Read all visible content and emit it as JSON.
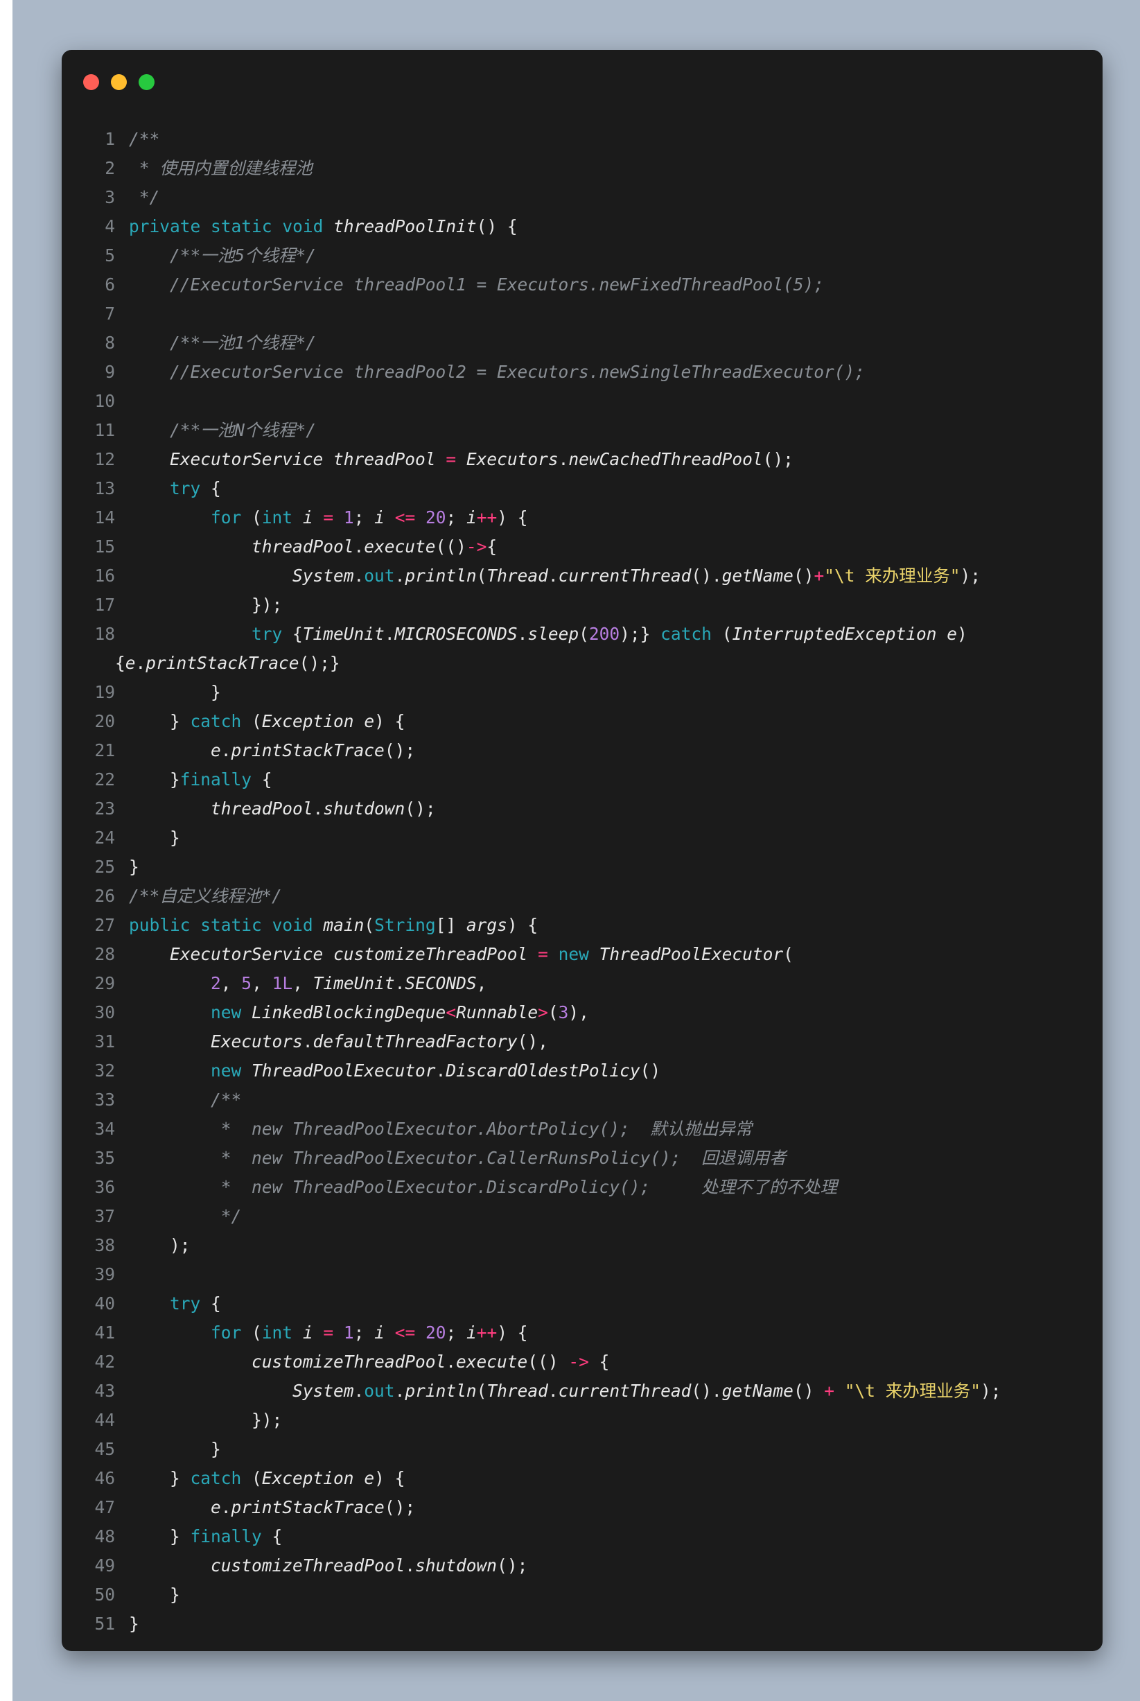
{
  "window": {
    "controls": [
      "close",
      "minimize",
      "maximize"
    ],
    "colors": {
      "close": "#ff5f56",
      "minimize": "#ffbd2e",
      "maximize": "#27c93f",
      "background": "#1b1b1b",
      "page_background": "#abb8c8"
    }
  },
  "palette": {
    "keyword": "#2aa8b8",
    "comment": "#8a8f95",
    "number": "#b77ee0",
    "operator": "#ff3d7f",
    "string": "#ead36a",
    "text": "#e6e6e6"
  },
  "lines": [
    {
      "n": "1",
      "tokens": [
        [
          "c",
          "/**"
        ]
      ]
    },
    {
      "n": "2",
      "tokens": [
        [
          "c",
          " * 使用内置创建线程池"
        ]
      ]
    },
    {
      "n": "3",
      "tokens": [
        [
          "c",
          " */"
        ]
      ]
    },
    {
      "n": "4",
      "tokens": [
        [
          "k",
          "private"
        ],
        [
          "p",
          " "
        ],
        [
          "k",
          "static"
        ],
        [
          "p",
          " "
        ],
        [
          "k",
          "void"
        ],
        [
          "p",
          " "
        ],
        [
          "it",
          "threadPoolInit"
        ],
        [
          "p",
          "() {"
        ]
      ]
    },
    {
      "n": "5",
      "tokens": [
        [
          "p",
          "    "
        ],
        [
          "c",
          "/**一池5个线程*/"
        ]
      ]
    },
    {
      "n": "6",
      "tokens": [
        [
          "p",
          "    "
        ],
        [
          "c",
          "//ExecutorService threadPool1 = Executors.newFixedThreadPool(5);"
        ]
      ]
    },
    {
      "n": "7",
      "tokens": []
    },
    {
      "n": "8",
      "tokens": [
        [
          "p",
          "    "
        ],
        [
          "c",
          "/**一池1个线程*/"
        ]
      ]
    },
    {
      "n": "9",
      "tokens": [
        [
          "p",
          "    "
        ],
        [
          "c",
          "//ExecutorService threadPool2 = Executors.newSingleThreadExecutor();"
        ]
      ]
    },
    {
      "n": "10",
      "tokens": []
    },
    {
      "n": "11",
      "tokens": [
        [
          "p",
          "    "
        ],
        [
          "c",
          "/**一池N个线程*/"
        ]
      ]
    },
    {
      "n": "12",
      "tokens": [
        [
          "p",
          "    "
        ],
        [
          "it",
          "ExecutorService"
        ],
        [
          "p",
          " "
        ],
        [
          "it",
          "threadPool"
        ],
        [
          "p",
          " "
        ],
        [
          "o",
          "="
        ],
        [
          "p",
          " "
        ],
        [
          "it",
          "Executors"
        ],
        [
          "p",
          "."
        ],
        [
          "it",
          "newCachedThreadPool"
        ],
        [
          "p",
          "();"
        ]
      ]
    },
    {
      "n": "13",
      "tokens": [
        [
          "p",
          "    "
        ],
        [
          "k",
          "try"
        ],
        [
          "p",
          " {"
        ]
      ]
    },
    {
      "n": "14",
      "tokens": [
        [
          "p",
          "        "
        ],
        [
          "k",
          "for"
        ],
        [
          "p",
          " ("
        ],
        [
          "k",
          "int"
        ],
        [
          "p",
          " "
        ],
        [
          "it",
          "i"
        ],
        [
          "p",
          " "
        ],
        [
          "o",
          "="
        ],
        [
          "p",
          " "
        ],
        [
          "n",
          "1"
        ],
        [
          "p",
          "; "
        ],
        [
          "it",
          "i"
        ],
        [
          "p",
          " "
        ],
        [
          "o",
          "<="
        ],
        [
          "p",
          " "
        ],
        [
          "n",
          "20"
        ],
        [
          "p",
          "; "
        ],
        [
          "it",
          "i"
        ],
        [
          "o",
          "++"
        ],
        [
          "p",
          ") {"
        ]
      ]
    },
    {
      "n": "15",
      "tokens": [
        [
          "p",
          "            "
        ],
        [
          "it",
          "threadPool"
        ],
        [
          "p",
          "."
        ],
        [
          "it",
          "execute"
        ],
        [
          "p",
          "(()"
        ],
        [
          "o",
          "->"
        ],
        [
          "p",
          "{"
        ]
      ]
    },
    {
      "n": "16",
      "tokens": [
        [
          "p",
          "                "
        ],
        [
          "it",
          "System"
        ],
        [
          "p",
          "."
        ],
        [
          "k",
          "out"
        ],
        [
          "p",
          "."
        ],
        [
          "it",
          "println"
        ],
        [
          "p",
          "("
        ],
        [
          "it",
          "Thread"
        ],
        [
          "p",
          "."
        ],
        [
          "it",
          "currentThread"
        ],
        [
          "p",
          "()."
        ],
        [
          "it",
          "getName"
        ],
        [
          "p",
          "()"
        ],
        [
          "o",
          "+"
        ],
        [
          "s",
          "\"\\t 来办理业务\""
        ],
        [
          "p",
          ");"
        ]
      ]
    },
    {
      "n": "17",
      "tokens": [
        [
          "p",
          "            });"
        ]
      ]
    },
    {
      "n": "18",
      "wrap": true,
      "tokens": [
        [
          "p",
          "            "
        ],
        [
          "k",
          "try"
        ],
        [
          "p",
          " {"
        ],
        [
          "it",
          "TimeUnit"
        ],
        [
          "p",
          "."
        ],
        [
          "it",
          "MICROSECONDS"
        ],
        [
          "p",
          "."
        ],
        [
          "it",
          "sleep"
        ],
        [
          "p",
          "("
        ],
        [
          "n",
          "200"
        ],
        [
          "p",
          ");} "
        ],
        [
          "k",
          "catch"
        ],
        [
          "p",
          " ("
        ],
        [
          "it",
          "InterruptedException"
        ],
        [
          "p",
          " "
        ],
        [
          "it",
          "e"
        ],
        [
          "p",
          ")"
        ]
      ],
      "cont": [
        [
          "p",
          "{"
        ],
        [
          "it",
          "e"
        ],
        [
          "p",
          "."
        ],
        [
          "it",
          "printStackTrace"
        ],
        [
          "p",
          "();}"
        ]
      ]
    },
    {
      "n": "19",
      "tokens": [
        [
          "p",
          "        }"
        ]
      ]
    },
    {
      "n": "20",
      "tokens": [
        [
          "p",
          "    } "
        ],
        [
          "k",
          "catch"
        ],
        [
          "p",
          " ("
        ],
        [
          "it",
          "Exception"
        ],
        [
          "p",
          " "
        ],
        [
          "it",
          "e"
        ],
        [
          "p",
          ") {"
        ]
      ]
    },
    {
      "n": "21",
      "tokens": [
        [
          "p",
          "        "
        ],
        [
          "it",
          "e"
        ],
        [
          "p",
          "."
        ],
        [
          "it",
          "printStackTrace"
        ],
        [
          "p",
          "();"
        ]
      ]
    },
    {
      "n": "22",
      "tokens": [
        [
          "p",
          "    }"
        ],
        [
          "k",
          "finally"
        ],
        [
          "p",
          " {"
        ]
      ]
    },
    {
      "n": "23",
      "tokens": [
        [
          "p",
          "        "
        ],
        [
          "it",
          "threadPool"
        ],
        [
          "p",
          "."
        ],
        [
          "it",
          "shutdown"
        ],
        [
          "p",
          "();"
        ]
      ]
    },
    {
      "n": "24",
      "tokens": [
        [
          "p",
          "    }"
        ]
      ]
    },
    {
      "n": "25",
      "tokens": [
        [
          "p",
          "}"
        ]
      ]
    },
    {
      "n": "26",
      "tokens": [
        [
          "c",
          "/**自定义线程池*/"
        ]
      ]
    },
    {
      "n": "27",
      "tokens": [
        [
          "k",
          "public"
        ],
        [
          "p",
          " "
        ],
        [
          "k",
          "static"
        ],
        [
          "p",
          " "
        ],
        [
          "k",
          "void"
        ],
        [
          "p",
          " "
        ],
        [
          "it",
          "main"
        ],
        [
          "p",
          "("
        ],
        [
          "k",
          "String"
        ],
        [
          "p",
          "[] "
        ],
        [
          "it",
          "args"
        ],
        [
          "p",
          ") {"
        ]
      ]
    },
    {
      "n": "28",
      "tokens": [
        [
          "p",
          "    "
        ],
        [
          "it",
          "ExecutorService"
        ],
        [
          "p",
          " "
        ],
        [
          "it",
          "customizeThreadPool"
        ],
        [
          "p",
          " "
        ],
        [
          "o",
          "="
        ],
        [
          "p",
          " "
        ],
        [
          "k",
          "new"
        ],
        [
          "p",
          " "
        ],
        [
          "it",
          "ThreadPoolExecutor"
        ],
        [
          "p",
          "("
        ]
      ]
    },
    {
      "n": "29",
      "tokens": [
        [
          "p",
          "        "
        ],
        [
          "n",
          "2"
        ],
        [
          "p",
          ", "
        ],
        [
          "n",
          "5"
        ],
        [
          "p",
          ", "
        ],
        [
          "n",
          "1L"
        ],
        [
          "p",
          ", "
        ],
        [
          "it",
          "TimeUnit"
        ],
        [
          "p",
          "."
        ],
        [
          "it",
          "SECONDS"
        ],
        [
          "p",
          ","
        ]
      ]
    },
    {
      "n": "30",
      "tokens": [
        [
          "p",
          "        "
        ],
        [
          "k",
          "new"
        ],
        [
          "p",
          " "
        ],
        [
          "it",
          "LinkedBlockingDeque"
        ],
        [
          "o",
          "<"
        ],
        [
          "it",
          "Runnable"
        ],
        [
          "o",
          ">"
        ],
        [
          "p",
          "("
        ],
        [
          "n",
          "3"
        ],
        [
          "p",
          "),"
        ]
      ]
    },
    {
      "n": "31",
      "tokens": [
        [
          "p",
          "        "
        ],
        [
          "it",
          "Executors"
        ],
        [
          "p",
          "."
        ],
        [
          "it",
          "defaultThreadFactory"
        ],
        [
          "p",
          "(),"
        ]
      ]
    },
    {
      "n": "32",
      "tokens": [
        [
          "p",
          "        "
        ],
        [
          "k",
          "new"
        ],
        [
          "p",
          " "
        ],
        [
          "it",
          "ThreadPoolExecutor"
        ],
        [
          "p",
          "."
        ],
        [
          "it",
          "DiscardOldestPolicy"
        ],
        [
          "p",
          "()"
        ]
      ]
    },
    {
      "n": "33",
      "tokens": [
        [
          "p",
          "        "
        ],
        [
          "c",
          "/**"
        ]
      ]
    },
    {
      "n": "34",
      "tokens": [
        [
          "p",
          "        "
        ],
        [
          "c",
          " *  new ThreadPoolExecutor.AbortPolicy();  默认抛出异常"
        ]
      ]
    },
    {
      "n": "35",
      "tokens": [
        [
          "p",
          "        "
        ],
        [
          "c",
          " *  new ThreadPoolExecutor.CallerRunsPolicy();  回退调用者"
        ]
      ]
    },
    {
      "n": "36",
      "tokens": [
        [
          "p",
          "        "
        ],
        [
          "c",
          " *  new ThreadPoolExecutor.DiscardPolicy();     处理不了的不处理"
        ]
      ]
    },
    {
      "n": "37",
      "tokens": [
        [
          "p",
          "        "
        ],
        [
          "c",
          " */"
        ]
      ]
    },
    {
      "n": "38",
      "tokens": [
        [
          "p",
          "    );"
        ]
      ]
    },
    {
      "n": "39",
      "tokens": []
    },
    {
      "n": "40",
      "tokens": [
        [
          "p",
          "    "
        ],
        [
          "k",
          "try"
        ],
        [
          "p",
          " {"
        ]
      ]
    },
    {
      "n": "41",
      "tokens": [
        [
          "p",
          "        "
        ],
        [
          "k",
          "for"
        ],
        [
          "p",
          " ("
        ],
        [
          "k",
          "int"
        ],
        [
          "p",
          " "
        ],
        [
          "it",
          "i"
        ],
        [
          "p",
          " "
        ],
        [
          "o",
          "="
        ],
        [
          "p",
          " "
        ],
        [
          "n",
          "1"
        ],
        [
          "p",
          "; "
        ],
        [
          "it",
          "i"
        ],
        [
          "p",
          " "
        ],
        [
          "o",
          "<="
        ],
        [
          "p",
          " "
        ],
        [
          "n",
          "20"
        ],
        [
          "p",
          "; "
        ],
        [
          "it",
          "i"
        ],
        [
          "o",
          "++"
        ],
        [
          "p",
          ") {"
        ]
      ]
    },
    {
      "n": "42",
      "tokens": [
        [
          "p",
          "            "
        ],
        [
          "it",
          "customizeThreadPool"
        ],
        [
          "p",
          "."
        ],
        [
          "it",
          "execute"
        ],
        [
          "p",
          "(() "
        ],
        [
          "o",
          "->"
        ],
        [
          "p",
          " {"
        ]
      ]
    },
    {
      "n": "43",
      "tokens": [
        [
          "p",
          "                "
        ],
        [
          "it",
          "System"
        ],
        [
          "p",
          "."
        ],
        [
          "k",
          "out"
        ],
        [
          "p",
          "."
        ],
        [
          "it",
          "println"
        ],
        [
          "p",
          "("
        ],
        [
          "it",
          "Thread"
        ],
        [
          "p",
          "."
        ],
        [
          "it",
          "currentThread"
        ],
        [
          "p",
          "()."
        ],
        [
          "it",
          "getName"
        ],
        [
          "p",
          "() "
        ],
        [
          "o",
          "+"
        ],
        [
          "p",
          " "
        ],
        [
          "s",
          "\"\\t 来办理业务\""
        ],
        [
          "p",
          ");"
        ]
      ]
    },
    {
      "n": "44",
      "tokens": [
        [
          "p",
          "            });"
        ]
      ]
    },
    {
      "n": "45",
      "tokens": [
        [
          "p",
          "        }"
        ]
      ]
    },
    {
      "n": "46",
      "tokens": [
        [
          "p",
          "    } "
        ],
        [
          "k",
          "catch"
        ],
        [
          "p",
          " ("
        ],
        [
          "it",
          "Exception"
        ],
        [
          "p",
          " "
        ],
        [
          "it",
          "e"
        ],
        [
          "p",
          ") {"
        ]
      ]
    },
    {
      "n": "47",
      "tokens": [
        [
          "p",
          "        "
        ],
        [
          "it",
          "e"
        ],
        [
          "p",
          "."
        ],
        [
          "it",
          "printStackTrace"
        ],
        [
          "p",
          "();"
        ]
      ]
    },
    {
      "n": "48",
      "tokens": [
        [
          "p",
          "    } "
        ],
        [
          "k",
          "finally"
        ],
        [
          "p",
          " {"
        ]
      ]
    },
    {
      "n": "49",
      "tokens": [
        [
          "p",
          "        "
        ],
        [
          "it",
          "customizeThreadPool"
        ],
        [
          "p",
          "."
        ],
        [
          "it",
          "shutdown"
        ],
        [
          "p",
          "();"
        ]
      ]
    },
    {
      "n": "50",
      "tokens": [
        [
          "p",
          "    }"
        ]
      ]
    },
    {
      "n": "51",
      "tokens": [
        [
          "p",
          "}"
        ]
      ]
    }
  ]
}
